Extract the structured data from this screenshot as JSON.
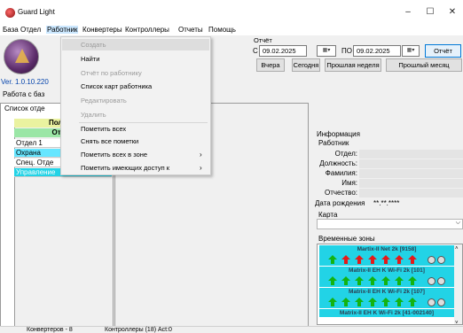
{
  "window": {
    "title": "Guard Light",
    "minimize": "–",
    "maximize": "☐",
    "close": "✕"
  },
  "menu": [
    "База",
    "Отдел",
    "Работник",
    "Конвертеры",
    "Контроллеры",
    "Отчеты",
    "Помощь"
  ],
  "version": "Ver. 1.0.10.220",
  "report": {
    "group_title": "Отчёт",
    "from_label": "С",
    "to_label": "ПО",
    "from_date": "09.02.2025",
    "to_date": "09.02.2025",
    "report_btn": "Отчёт",
    "yesterday_btn": "Вчера",
    "today_btn": "Сегодня",
    "last_week_btn": "Прошлая неделя",
    "last_month_btn": "Прошлый месяц"
  },
  "work_strip": "Работа с баз",
  "departments": {
    "title": "Список отде",
    "header_full": "Полный",
    "header_mark": "Отмеч",
    "items": [
      {
        "label": "Отдел 1",
        "color": "#ffffff"
      },
      {
        "label": "Охрана",
        "color": "#66e6ff"
      },
      {
        "label": "Спец. Отде",
        "color": "#ffffff"
      },
      {
        "label": "Управление",
        "color": "#22d3e6"
      }
    ]
  },
  "info": {
    "title": "Информация",
    "worker_title": "Работник",
    "labels": [
      "Отдел:",
      "Должность:",
      "Фамилия:",
      "Имя:",
      "Отчество:"
    ],
    "birth_label": "Дата рождения",
    "birth_value": "**.**.****",
    "card_title": "Карта",
    "tz_title": "Временные зоны"
  },
  "time_zones": [
    {
      "name": "Martix-II Net 2k [9158]",
      "arrows": [
        "green",
        "red",
        "red",
        "red",
        "red",
        "red",
        "red"
      ]
    },
    {
      "name": "Matrix-II EH K Wi-Fi 2k [101]",
      "arrows": [
        "green",
        "green",
        "green",
        "green",
        "green",
        "green",
        "green"
      ]
    },
    {
      "name": "Matrix-II EH K Wi-Fi 2k [107]",
      "arrows": [
        "green",
        "green",
        "green",
        "green",
        "green",
        "green",
        "green"
      ]
    },
    {
      "name": "Matrix-II EH K Wi-Fi 2k [41-002140]",
      "arrows": []
    }
  ],
  "status": {
    "converters": "Конвертеров - 8",
    "controllers": "Контроллеры (18) Act:0"
  },
  "dropdown": {
    "items": [
      {
        "label": "Создать",
        "disabled": true
      },
      {
        "label": "Найти",
        "disabled": false
      },
      {
        "label": "Отчёт по работнику",
        "disabled": true
      },
      {
        "label": "Список карт работника",
        "disabled": false
      },
      {
        "label": "Редактировать",
        "disabled": true
      },
      {
        "label": "Удалить",
        "disabled": true
      },
      {
        "label": "Пометить всех",
        "disabled": false
      },
      {
        "label": "Снять все пометки",
        "disabled": false
      },
      {
        "label": "Пометить всех в зоне",
        "disabled": false,
        "submenu": true
      },
      {
        "label": "Пометить имеющих доступ к",
        "disabled": false,
        "submenu": true
      }
    ]
  }
}
